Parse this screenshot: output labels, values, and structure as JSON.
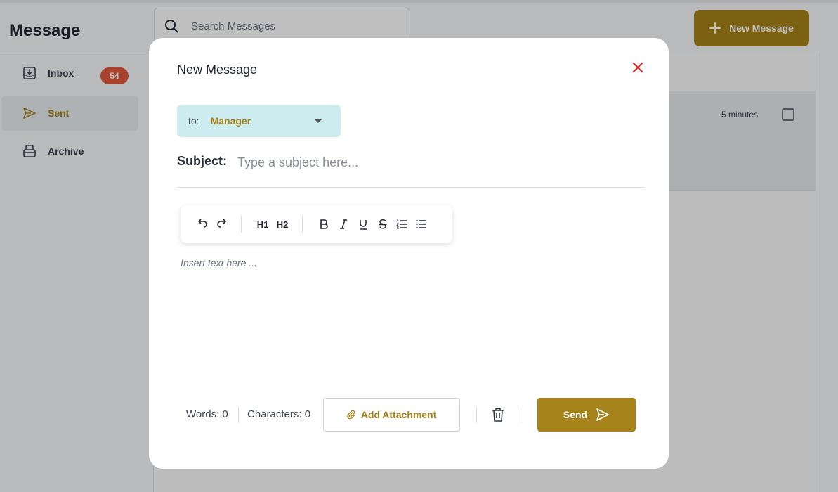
{
  "app": {
    "title": "Message",
    "search_placeholder": "Search Messages",
    "new_message_label": "New Message"
  },
  "sidebar": {
    "items": [
      {
        "label": "Inbox",
        "icon": "inbox-icon",
        "badge": "54"
      },
      {
        "label": "Sent",
        "icon": "send-icon",
        "active": true
      },
      {
        "label": "Archive",
        "icon": "archive-icon"
      }
    ]
  },
  "message_list": {
    "rows": [
      {
        "time": "5 minutes"
      }
    ]
  },
  "modal": {
    "title": "New Message",
    "to_label": "to:",
    "to_value": "Manager",
    "subject_label": "Subject:",
    "subject_placeholder": "Type a subject here...",
    "editor_placeholder": "Insert text here ...",
    "toolbar": {
      "h1": "H1",
      "h2": "H2"
    },
    "words_label": "Words: 0",
    "characters_label": "Characters: 0",
    "attachment_label": "Add Attachment",
    "send_label": "Send"
  },
  "colors": {
    "accent": "#a6821a",
    "badge": "#e0573e",
    "close": "#e02424",
    "to_field_bg": "#cdecef"
  }
}
